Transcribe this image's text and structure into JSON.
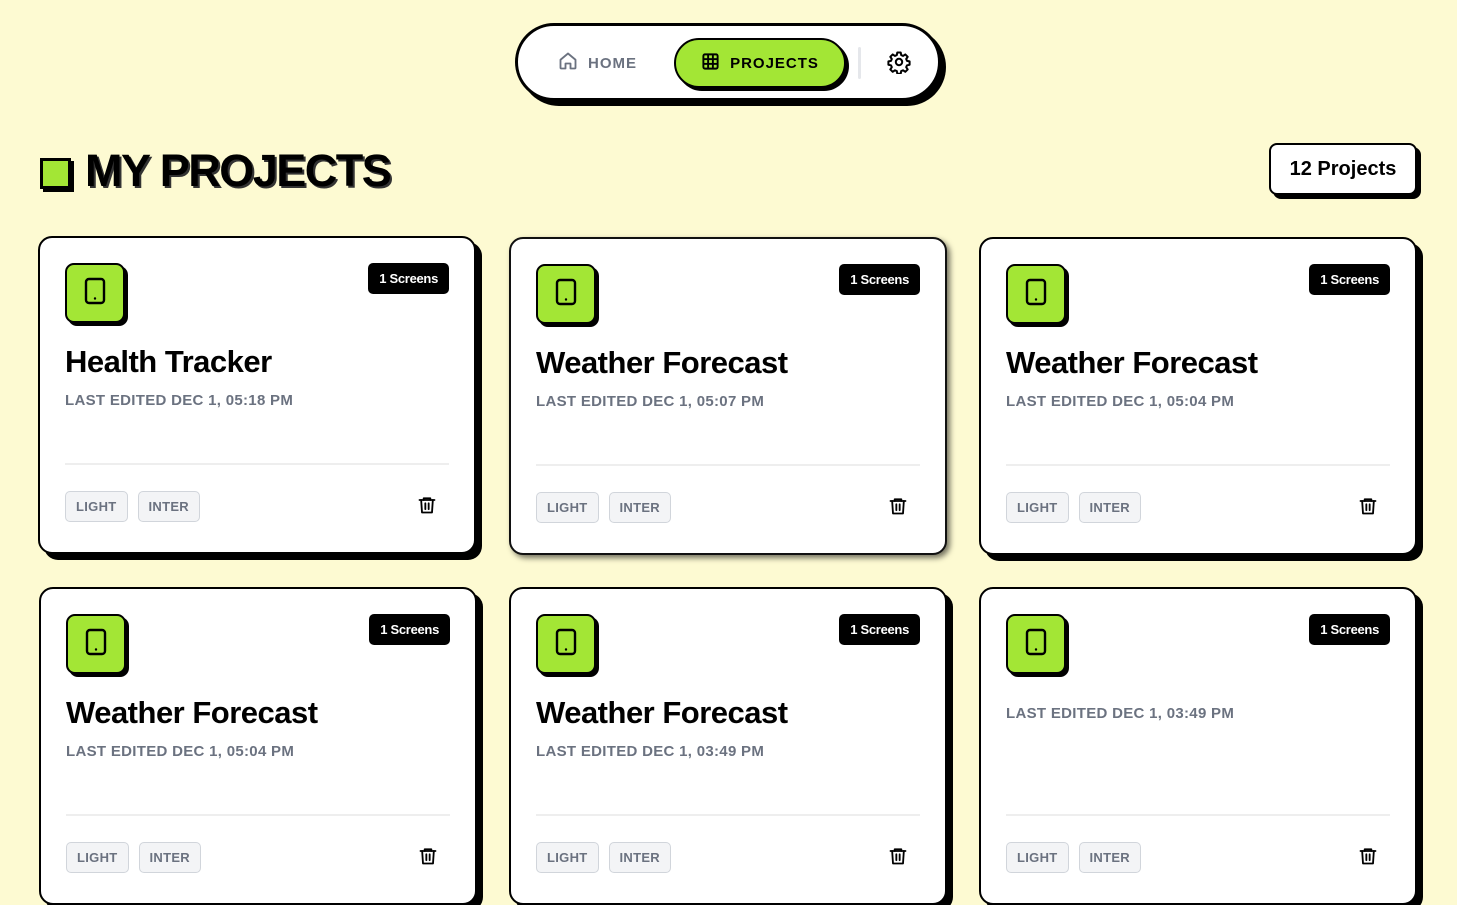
{
  "nav": {
    "home_label": "HOME",
    "projects_label": "PROJECTS",
    "settings_icon": "gear-icon"
  },
  "header": {
    "title": "MY PROJECTS",
    "count_label": "12 Projects"
  },
  "colors": {
    "background": "#fdfad2",
    "accent": "#a3e635",
    "ink": "#000000",
    "muted": "#6b7280"
  },
  "projects": [
    {
      "title": "Health Tracker",
      "date": "LAST EDITED DEC 1, 05:18 PM",
      "screens": "1 Screens",
      "tags": [
        "LIGHT",
        "INTER"
      ]
    },
    {
      "title": "Weather Forecast",
      "date": "LAST EDITED DEC 1, 05:07 PM",
      "screens": "1 Screens",
      "tags": [
        "LIGHT",
        "INTER"
      ]
    },
    {
      "title": "Weather Forecast",
      "date": "LAST EDITED DEC 1, 05:04 PM",
      "screens": "1 Screens",
      "tags": [
        "LIGHT",
        "INTER"
      ]
    },
    {
      "title": "Weather Forecast",
      "date": "LAST EDITED DEC 1, 05:04 PM",
      "screens": "1 Screens",
      "tags": [
        "LIGHT",
        "INTER"
      ]
    },
    {
      "title": "Weather Forecast",
      "date": "LAST EDITED DEC 1, 03:49 PM",
      "screens": "1 Screens",
      "tags": [
        "LIGHT",
        "INTER"
      ]
    },
    {
      "title": "",
      "date": "LAST EDITED DEC 1, 03:49 PM",
      "screens": "1 Screens",
      "tags": [
        "LIGHT",
        "INTER"
      ]
    }
  ]
}
